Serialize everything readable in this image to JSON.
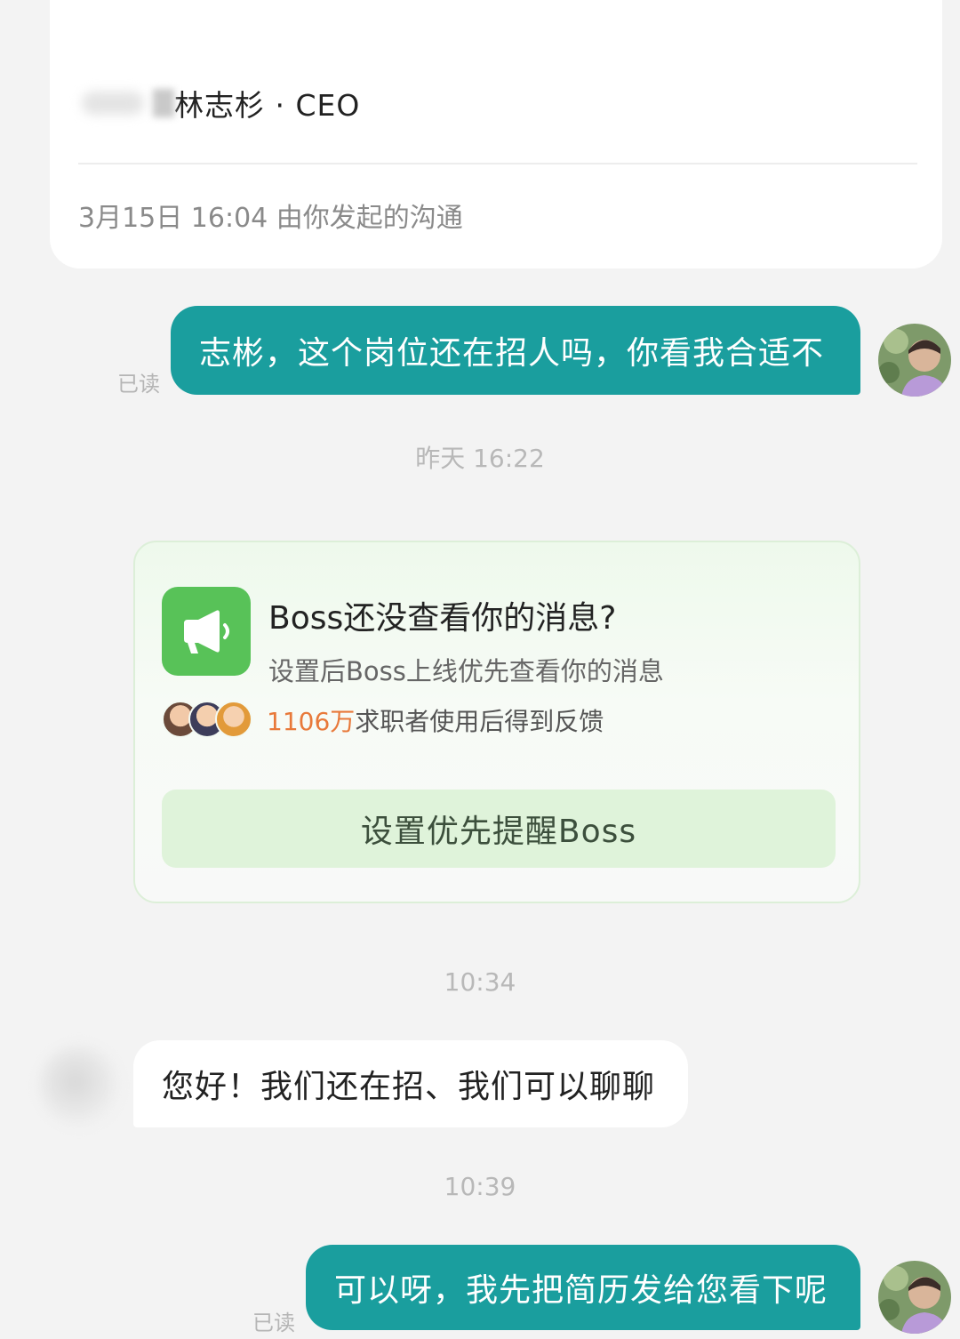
{
  "header": {
    "contact_name": "林志杉 · CEO",
    "origin": "3月15日 16:04 由你发起的沟通"
  },
  "messages": [
    {
      "direction": "sent",
      "text": "志彬，这个岗位还在招人吗，你看我合适不",
      "status": "已读"
    },
    {
      "direction": "received",
      "text": "您好！我们还在招、我们可以聊聊"
    },
    {
      "direction": "sent",
      "text": "可以呀，我先把简历发给您看下呢",
      "status": "已读"
    }
  ],
  "timestamps": [
    "昨天 16:22",
    "10:34",
    "10:39"
  ],
  "promo": {
    "title": "Boss还没查看你的消息?",
    "subtitle": "设置后Boss上线优先查看你的消息",
    "stat_number": "1106万",
    "stat_text": "求职者使用后得到反馈",
    "button_label": "设置优先提醒Boss"
  },
  "colors": {
    "sent_bubble": "#1a9e9e",
    "promo_icon": "#58c258",
    "stat_highlight": "#e8793a",
    "background": "#f3f3f3"
  },
  "icons": {
    "promo": "megaphone-icon"
  }
}
